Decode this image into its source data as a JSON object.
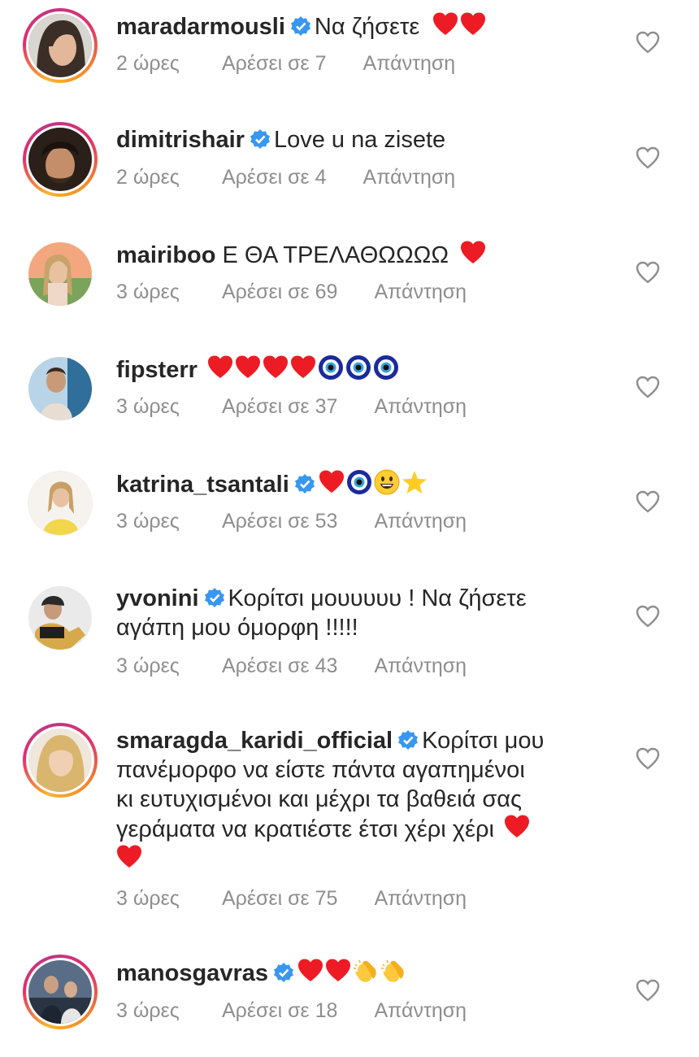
{
  "comments": [
    {
      "username": "maradarmousli",
      "verified": true,
      "text": "Να ζήσετε",
      "emojis": [
        "red-heart",
        "red-heart"
      ],
      "time": "2 ώρες",
      "likes": "Αρέσει σε 7",
      "reply": "Απάντηση",
      "story_ring": true
    },
    {
      "username": "dimitrishair",
      "verified": true,
      "text": "Love u na zisete",
      "emojis": [],
      "time": "2 ώρες",
      "likes": "Αρέσει σε 4",
      "reply": "Απάντηση",
      "story_ring": true
    },
    {
      "username": "mairiboo",
      "verified": false,
      "text": "Ε ΘΑ ΤΡΕΛΑΘΩΩΩΩ",
      "emojis": [
        "red-heart"
      ],
      "time": "3 ώρες",
      "likes": "Αρέσει σε 69",
      "reply": "Απάντηση",
      "story_ring": false
    },
    {
      "username": "fipsterr",
      "verified": false,
      "text": "",
      "emojis": [
        "red-heart",
        "red-heart",
        "red-heart",
        "red-heart",
        "nazar-amulet",
        "nazar-amulet",
        "nazar-amulet"
      ],
      "time": "3 ώρες",
      "likes": "Αρέσει σε 37",
      "reply": "Απάντηση",
      "story_ring": false
    },
    {
      "username": "katrina_tsantali",
      "verified": true,
      "text": "",
      "emojis": [
        "red-heart",
        "nazar-amulet",
        "grinning-face",
        "star"
      ],
      "time": "3 ώρες",
      "likes": "Αρέσει σε 53",
      "reply": "Απάντηση",
      "story_ring": false
    },
    {
      "username": "yvonini",
      "verified": true,
      "text_lines": [
        "Κορίτσι μουυυυυ ! Να ζήσετε",
        "αγάπη μου όμορφη !!!!!"
      ],
      "emojis": [],
      "time": "3 ώρες",
      "likes": "Αρέσει σε 43",
      "reply": "Απάντηση",
      "story_ring": false
    },
    {
      "username": "smaragda_karidi_official",
      "verified": true,
      "text_lines": [
        "Κορίτσι μου",
        "πανέμορφο να είστε πάντα αγαπημένοι",
        "κι ευτυχισμένοι και μέχρι  τα βαθειά σας",
        "γεράματα να κρατιέστε έτσι χέρι χέρι"
      ],
      "emojis_line4": [
        "red-heart"
      ],
      "emojis_line5": [
        "red-heart"
      ],
      "time": "3 ώρες",
      "likes": "Αρέσει σε 75",
      "reply": "Απάντηση",
      "story_ring": true
    },
    {
      "username": "manosgavras",
      "verified": true,
      "text": "",
      "emojis": [
        "red-heart",
        "red-heart",
        "clapping-hands",
        "clapping-hands"
      ],
      "time": "3 ώρες",
      "likes": "Αρέσει σε 18",
      "reply": "Απάντηση",
      "story_ring": true
    }
  ],
  "colors": {
    "text": "#262626",
    "meta": "#8e8e8e",
    "verified_blue": "#3897f0",
    "heart_red": "#ed1c24"
  },
  "icons": {
    "like": "heart-outline-icon",
    "verified": "verified-badge-icon"
  }
}
